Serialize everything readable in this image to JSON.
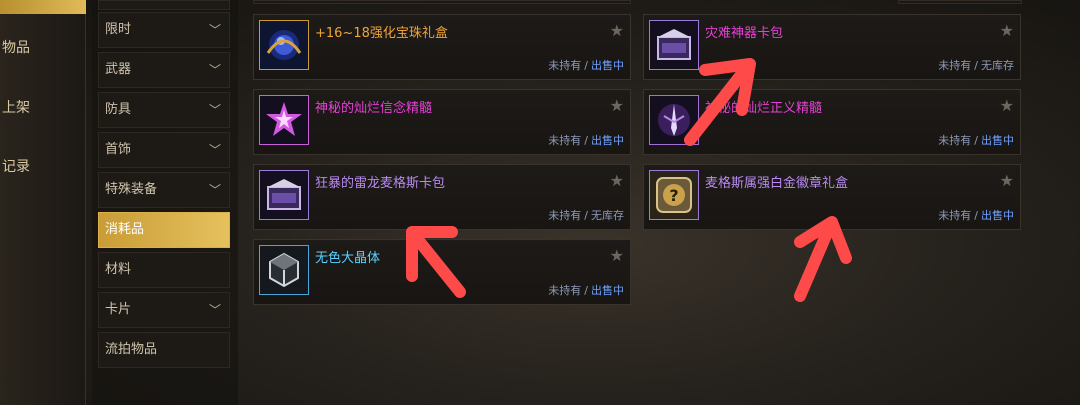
{
  "leftnav": {
    "items": [
      {
        "label": "物品"
      },
      {
        "label": "上架"
      },
      {
        "label": "记录"
      }
    ]
  },
  "categories": [
    {
      "label": "限时",
      "chevron": "chevron-down"
    },
    {
      "label": "武器",
      "chevron": "chevron-down"
    },
    {
      "label": "防具",
      "chevron": "chevron-down"
    },
    {
      "label": "首饰",
      "chevron": "chevron-down"
    },
    {
      "label": "特殊装备",
      "chevron": "chevron-down"
    },
    {
      "label": "消耗品",
      "active": true
    },
    {
      "label": "材料"
    },
    {
      "label": "卡片",
      "chevron": "chevron-down"
    },
    {
      "label": "流拍物品"
    }
  ],
  "items": [
    {
      "name": "+16~18强化宝珠礼盒",
      "color": "#f0a43a",
      "icon": "orb-box-icon",
      "owned": "未持有",
      "sep": "/",
      "stock": "出售中"
    },
    {
      "name": "灾难神器卡包",
      "color": "#e640d6",
      "icon": "card-pack-icon",
      "owned": "未持有",
      "sep": "/",
      "stock": "无库存"
    },
    {
      "name": "神秘的灿烂信念精髓",
      "color": "#e640d6",
      "icon": "star-essence-icon",
      "owned": "未持有",
      "sep": "/",
      "stock": "出售中"
    },
    {
      "name": "神秘的灿烂正义精髓",
      "color": "#e640d6",
      "icon": "sword-essence-icon",
      "owned": "未持有",
      "sep": "/",
      "stock": "出售中"
    },
    {
      "name": "狂暴的雷龙麦格斯卡包",
      "color": "#b88af0",
      "icon": "card-pack-icon",
      "owned": "未持有",
      "sep": "/",
      "stock": "无库存"
    },
    {
      "name": "麦格斯属强白金徽章礼盒",
      "color": "#b88af0",
      "icon": "mystery-box-icon",
      "owned": "未持有",
      "sep": "/",
      "stock": "出售中"
    },
    {
      "name": "无色大晶体",
      "color": "#59d2ff",
      "icon": "crystal-icon",
      "owned": "未持有",
      "sep": "/",
      "stock": "出售中"
    }
  ],
  "colors": {
    "accent_gold": "#d9b04a",
    "arrow_red": "#ff4a4a",
    "sale_blue": "#6fa0ff"
  }
}
